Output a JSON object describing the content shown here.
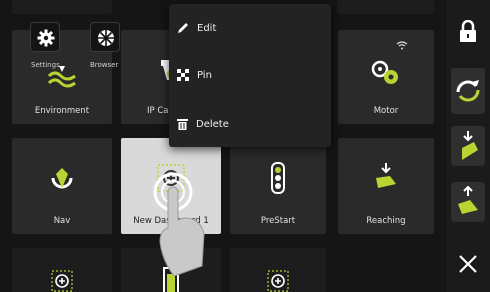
{
  "colors": {
    "accent": "#b8d433",
    "tile_bg": "#2a2a2a",
    "selected_tile_bg": "#d9d9d9",
    "menu_bg": "#232323"
  },
  "top_buttons": [
    {
      "label": "Settings",
      "icon": "gear-icon"
    },
    {
      "label": "Browser",
      "icon": "globe-icon"
    }
  ],
  "tiles": [
    {
      "label": "Environment",
      "icon": "environment-icon"
    },
    {
      "label": "IP Ca",
      "icon": "camera-icon"
    },
    {
      "label": "Motor",
      "icon": "motor-icon"
    },
    {
      "label": "Nav",
      "icon": "nav-icon"
    },
    {
      "label": "New Dashboard 1",
      "icon": "add-circle-icon"
    },
    {
      "label": "PreStart",
      "icon": "traffic-light-icon"
    },
    {
      "label": "Reaching",
      "icon": "reaching-icon"
    }
  ],
  "context_menu": {
    "items": [
      {
        "label": "Edit",
        "icon": "pencil-icon"
      },
      {
        "label": "Pin",
        "icon": "pin-icon"
      },
      {
        "label": "Delete",
        "icon": "trash-icon"
      }
    ]
  },
  "sidebar": {
    "buttons": [
      "lock-icon",
      "refresh-icon",
      "reach-down-icon",
      "reach-up-icon",
      "close-icon"
    ]
  }
}
